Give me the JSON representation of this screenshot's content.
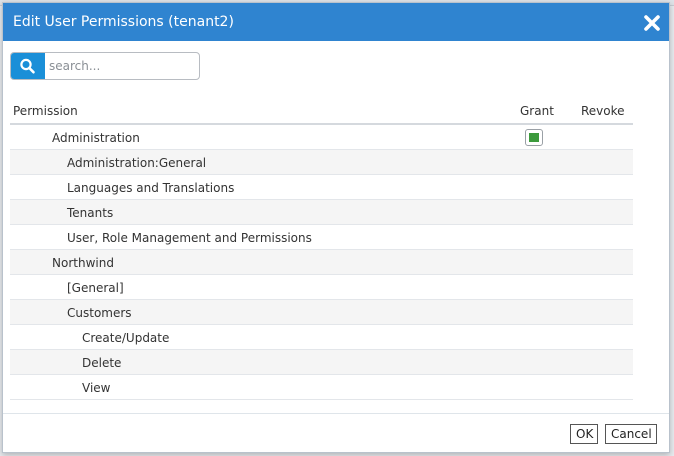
{
  "dialog": {
    "title": "Edit User Permissions (tenant2)"
  },
  "search": {
    "placeholder": "search...",
    "value": ""
  },
  "grid": {
    "columns": {
      "permission": "Permission",
      "grant": "Grant",
      "revoke": "Revoke"
    },
    "rows": [
      {
        "label": "Administration",
        "level": 1,
        "grant": true
      },
      {
        "label": "Administration:General",
        "level": 2,
        "grant": false
      },
      {
        "label": "Languages and Translations",
        "level": 2,
        "grant": false
      },
      {
        "label": "Tenants",
        "level": 2,
        "grant": false
      },
      {
        "label": "User, Role Management and Permissions",
        "level": 2,
        "grant": false
      },
      {
        "label": "Northwind",
        "level": 1,
        "grant": false
      },
      {
        "label": "[General]",
        "level": 2,
        "grant": false
      },
      {
        "label": "Customers",
        "level": 2,
        "grant": false
      },
      {
        "label": "Create/Update",
        "level": 3,
        "grant": false
      },
      {
        "label": "Delete",
        "level": 3,
        "grant": false
      },
      {
        "label": "View",
        "level": 3,
        "grant": false
      }
    ]
  },
  "buttons": {
    "ok": "OK",
    "cancel": "Cancel"
  },
  "colors": {
    "titlebar": "#2f84d0",
    "search_button": "#1a8fd8",
    "grant_fill": "#3c9a3c"
  }
}
